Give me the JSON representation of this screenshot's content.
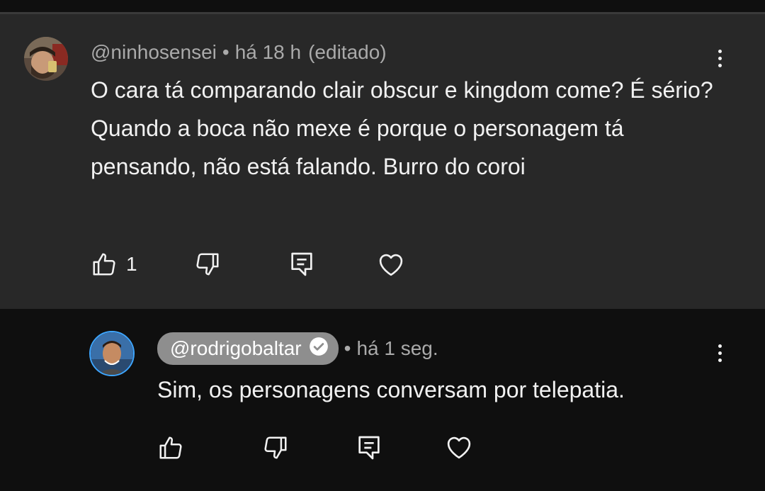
{
  "comment": {
    "handle": "@ninhosensei",
    "separator": "•",
    "time": "há 18 h",
    "edited": "(editado)",
    "text": "O cara tá comparando clair obscur e kingdom come? É sério? Quando a boca não mexe é porque o personagem tá pensando, não está falando. Burro do coroi",
    "likes": "1"
  },
  "reply": {
    "handle": "@rodrigobaltar",
    "separator": "•",
    "time": "há 1 seg.",
    "text": "Sim, os personagens conversam por telepatia.",
    "verified": true
  },
  "icons": {
    "like": "thumbs-up-icon",
    "dislike": "thumbs-down-icon",
    "reply": "reply-comment-icon",
    "heart": "heart-icon",
    "more": "more-vertical-icon"
  },
  "colors": {
    "comment_bg": "#282828",
    "reply_bg": "#0f0f0f",
    "meta_text": "#aaaaaa",
    "body_text": "#f1f1f1"
  }
}
